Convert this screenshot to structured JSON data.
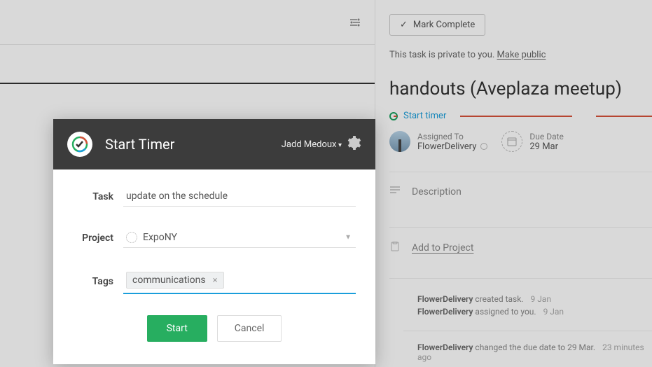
{
  "sidePanel": {
    "markComplete": "Mark Complete",
    "privatePrefix": "This task is private to you. ",
    "makePublic": "Make public",
    "taskTitle": "handouts (Aveplaza meetup)",
    "startTimer": "Start timer",
    "assignedLabel": "Assigned To",
    "assignedValue": "FlowerDelivery",
    "dueLabel": "Due Date",
    "dueValue": "29 Mar",
    "descriptionLabel": "Description",
    "addToProject": "Add to Project",
    "activity": [
      {
        "actor": "FlowerDelivery",
        "action": " created task.",
        "time": "9 Jan"
      },
      {
        "actor": "FlowerDelivery",
        "action": " assigned to you.",
        "time": "9 Jan"
      },
      {
        "actor": "FlowerDelivery",
        "action": " changed the due date to 29 Mar.",
        "time": "23 minutes ago"
      }
    ]
  },
  "modal": {
    "title": "Start Timer",
    "user": "Jadd Medoux",
    "taskLabel": "Task",
    "taskValue": "update on the schedule",
    "projectLabel": "Project",
    "projectValue": "ExpoNY",
    "tagsLabel": "Tags",
    "tagValue": "communications",
    "startBtn": "Start",
    "cancelBtn": "Cancel"
  }
}
